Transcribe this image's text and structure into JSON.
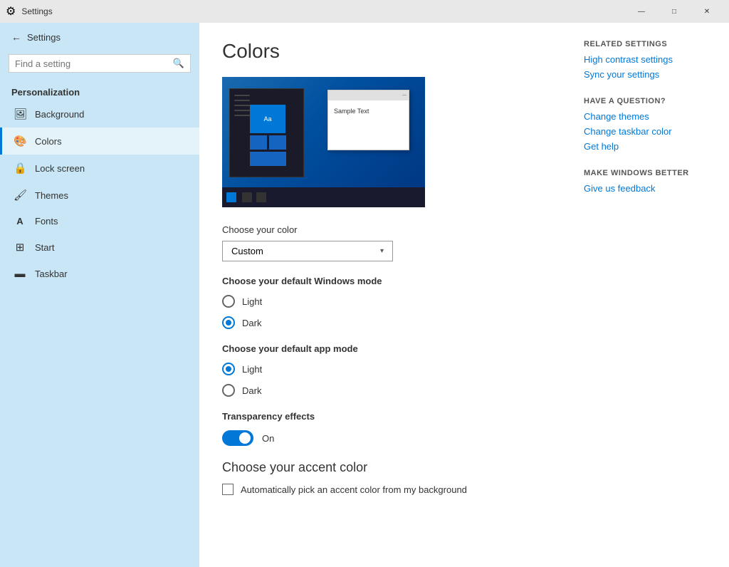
{
  "titlebar": {
    "title": "Settings",
    "minimize": "—",
    "maximize": "□",
    "close": "✕"
  },
  "sidebar": {
    "back_label": "Settings",
    "search_placeholder": "Find a setting",
    "section_title": "Personalization",
    "items": [
      {
        "id": "background",
        "label": "Background",
        "icon": "🖼"
      },
      {
        "id": "colors",
        "label": "Colors",
        "icon": "🎨"
      },
      {
        "id": "lock-screen",
        "label": "Lock screen",
        "icon": "🔒"
      },
      {
        "id": "themes",
        "label": "Themes",
        "icon": "🖌"
      },
      {
        "id": "fonts",
        "label": "Fonts",
        "icon": "A"
      },
      {
        "id": "start",
        "label": "Start",
        "icon": "⊞"
      },
      {
        "id": "taskbar",
        "label": "Taskbar",
        "icon": "▬"
      }
    ]
  },
  "main": {
    "title": "Colors",
    "preview_alt": "Color preview showing dark theme",
    "preview_sample_text": "Sample Text",
    "preview_aa_text": "Aa",
    "choose_color_label": "Choose your color",
    "color_dropdown_value": "Custom",
    "windows_mode_label": "Choose your default Windows mode",
    "windows_mode_options": [
      "Light",
      "Dark"
    ],
    "windows_mode_selected": "Dark",
    "app_mode_label": "Choose your default app mode",
    "app_mode_options": [
      "Light",
      "Dark"
    ],
    "app_mode_selected": "Light",
    "transparency_label": "Transparency effects",
    "transparency_value": "On",
    "transparency_on": true,
    "accent_title": "Choose your accent color",
    "auto_accent_label": "Automatically pick an accent color from my background",
    "auto_accent_checked": false
  },
  "right_panel": {
    "related_title": "Related Settings",
    "related_links": [
      "High contrast settings",
      "Sync your settings"
    ],
    "question_title": "Have a question?",
    "question_links": [
      "Change themes",
      "Change taskbar color",
      "Get help"
    ],
    "improve_title": "Make Windows better",
    "improve_links": [
      "Give us feedback"
    ]
  }
}
